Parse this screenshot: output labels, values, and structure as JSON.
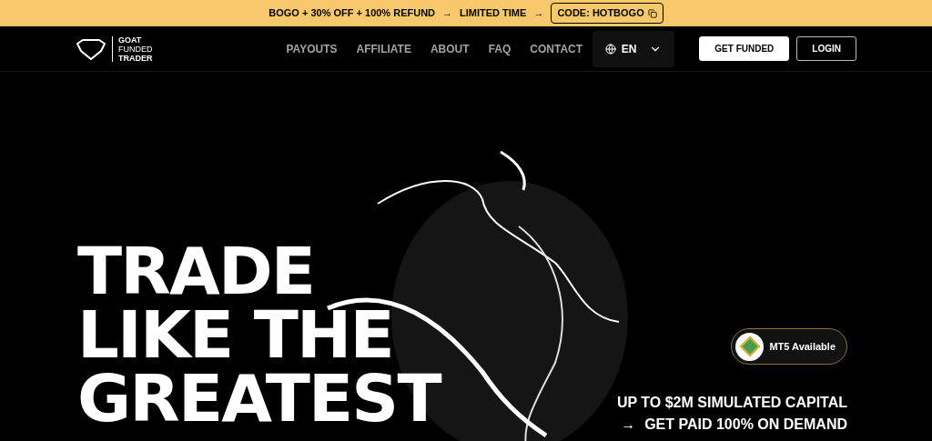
{
  "promo_bar": {
    "offer": "BOGO + 30% OFF + 100% REFUND",
    "arrow_1": "→",
    "limited": "LIMITED TIME",
    "arrow_2": "→",
    "code": "CODE: HOTBOGO"
  },
  "logo": {
    "lines": [
      "GOAT",
      "FUNDED",
      "TRADER"
    ]
  },
  "nav": {
    "links": [
      "PAYOUTS",
      "AFFILIATE",
      "ABOUT",
      "FAQ",
      "CONTACT"
    ],
    "language": "EN",
    "buttons": [
      {
        "label": "GET FUNDED",
        "kind": "filled"
      },
      {
        "label": "LOGIN",
        "kind": "outline"
      }
    ]
  },
  "hero": {
    "heading_lines": [
      "TRADE",
      "LIKE THE",
      "GREATEST"
    ],
    "badge": "MT5 Available",
    "tagline_1": "UP TO $2M SIMULATED CAPITAL",
    "tagline_arrow": "→",
    "tagline_2": "GET PAID 100% ON DEMAND"
  }
}
